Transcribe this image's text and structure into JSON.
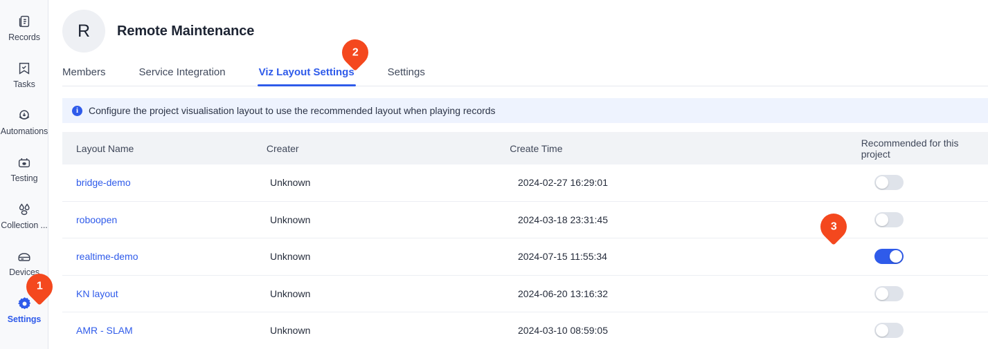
{
  "sidebar": {
    "items": [
      {
        "label": "Records",
        "icon": "records-icon",
        "active": false
      },
      {
        "label": "Tasks",
        "icon": "tasks-icon",
        "active": false
      },
      {
        "label": "Automations",
        "icon": "automations-icon",
        "active": false
      },
      {
        "label": "Testing",
        "icon": "testing-icon",
        "active": false
      },
      {
        "label": "Collection ...",
        "icon": "collection-icon",
        "active": false
      },
      {
        "label": "Devices",
        "icon": "devices-icon",
        "active": false
      },
      {
        "label": "Settings",
        "icon": "gear-icon",
        "active": true
      }
    ]
  },
  "header": {
    "avatar_initial": "R",
    "project_title": "Remote Maintenance"
  },
  "tabs": [
    {
      "label": "Members",
      "active": false
    },
    {
      "label": "Service Integration",
      "active": false
    },
    {
      "label": "Viz Layout Settings",
      "active": true
    },
    {
      "label": "Settings",
      "active": false
    }
  ],
  "banner": {
    "icon": "info-icon",
    "text": "Configure the project visualisation layout to use the recommended layout when playing records"
  },
  "table": {
    "columns": [
      "Layout Name",
      "Creater",
      "Create Time",
      "Recommended for this project"
    ],
    "rows": [
      {
        "layout_name": "bridge-demo",
        "creater": "Unknown",
        "create_time": "2024-02-27 16:29:01",
        "recommended": false
      },
      {
        "layout_name": "roboopen",
        "creater": "Unknown",
        "create_time": "2024-03-18 23:31:45",
        "recommended": false
      },
      {
        "layout_name": "realtime-demo",
        "creater": "Unknown",
        "create_time": "2024-07-15 11:55:34",
        "recommended": true
      },
      {
        "layout_name": "KN layout",
        "creater": "Unknown",
        "create_time": "2024-06-20 13:16:32",
        "recommended": false
      },
      {
        "layout_name": "AMR - SLAM",
        "creater": "Unknown",
        "create_time": "2024-03-10 08:59:05",
        "recommended": false
      }
    ]
  },
  "annotations": [
    {
      "number": "1",
      "target": "sidebar-item-settings"
    },
    {
      "number": "2",
      "target": "tab-viz-layout-settings"
    },
    {
      "number": "3",
      "target": "toggle-row-3"
    }
  ],
  "colors": {
    "accent_blue": "#2f5bea",
    "badge_orange": "#f4481e",
    "banner_bg": "#eef3fe",
    "table_header_bg": "#f1f3f6",
    "sidebar_bg": "#f8f9fb"
  }
}
